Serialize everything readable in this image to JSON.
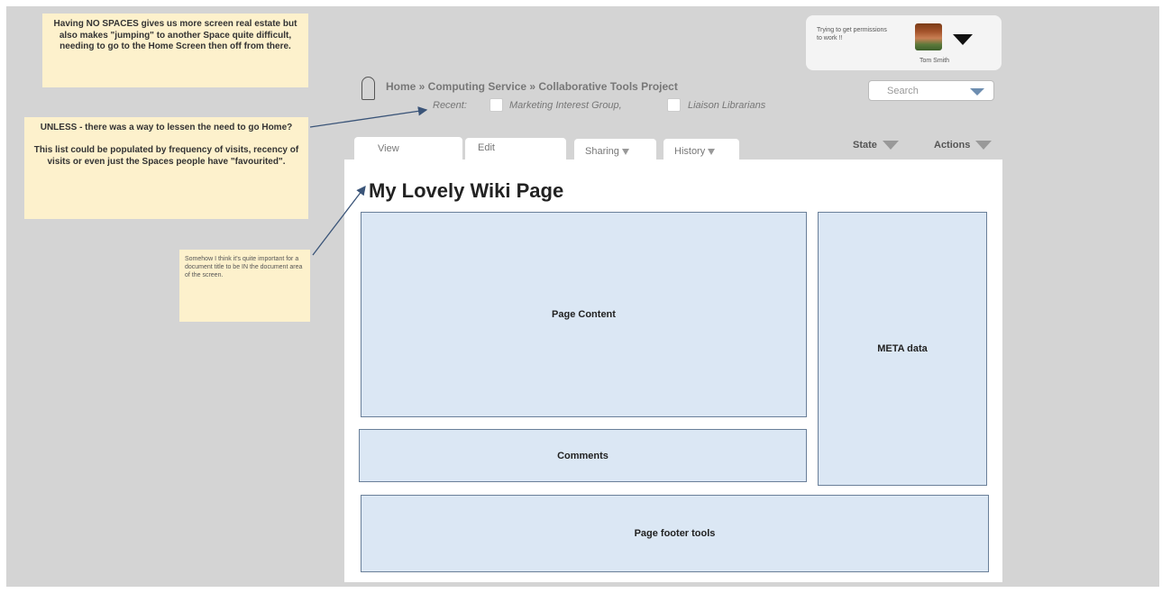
{
  "notes": {
    "spaces": "Having NO SPACES gives us more screen real estate but also makes \"jumping\" to another Space quite difficult, needing to go to the Home Screen then off from there.",
    "unless": "UNLESS - there was a way to lessen the need to go Home?\n\nThis list could be populated by frequency of visits, recency of visits or even just the Spaces people have \"favourited\".",
    "title_note": "Somehow I think it's quite important for a document title to be IN the document area of the screen."
  },
  "user": {
    "status": "Trying to get permissions to work !!",
    "name": "Tom Smith"
  },
  "search": {
    "placeholder": "Search"
  },
  "breadcrumb": {
    "path": "Home » Computing Service » Collaborative Tools Project",
    "recent_label": "Recent:",
    "recent_items": [
      "Marketing Interest Group,",
      "Liaison Librarians"
    ]
  },
  "tabs": {
    "view": "View",
    "edit": "Edit",
    "sharing": "Sharing",
    "history": "History"
  },
  "menus": {
    "state": "State",
    "actions": "Actions"
  },
  "page": {
    "title": "My Lovely Wiki Page",
    "content": "Page Content",
    "meta": "META data",
    "comments": "Comments",
    "footer": "Page footer tools"
  }
}
